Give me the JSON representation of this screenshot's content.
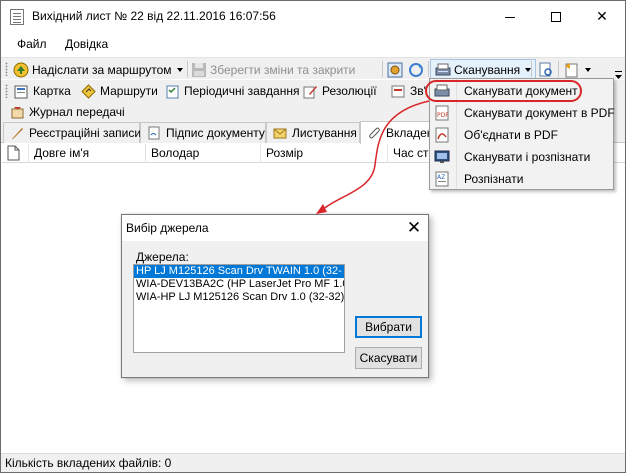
{
  "window": {
    "title": "Вихідний лист № 22 від 22.11.2016 16:07:56"
  },
  "menubar": {
    "items": [
      "Файл",
      "Довідка"
    ]
  },
  "toolbar": {
    "send_route": "Надіслати за маршрутом",
    "save_close": "Зберегти зміни та закрити",
    "scan": "Сканування"
  },
  "tabs_row1": [
    "Картка",
    "Маршрути",
    "Періодичні завдання",
    "Резолюції",
    "Зв'"
  ],
  "tabs_row2": [
    "Журнал передачі"
  ],
  "page_tabs": [
    "Реєстраційні записи",
    "Підпис документу",
    "Листування",
    "Вкладен"
  ],
  "grid": {
    "columns": [
      "Довге ім'я",
      "Володар",
      "Розмір",
      "Час ств"
    ]
  },
  "scan_menu": {
    "items": [
      "Сканувати документ",
      "Сканувати документ в PDF",
      "Об'єднати в PDF",
      "Сканувати і розпізнати",
      "Розпізнати"
    ]
  },
  "dialog": {
    "title": "Вибір джерела",
    "sources_label": "Джерела:",
    "sources": [
      "HP LJ M125126 Scan Drv TWAIN 1.0 (32-",
      "WIA-DEV13BA2C (HP LaserJet Pro MF 1.0",
      "WIA-HP LJ M125126 Scan Drv 1.0 (32-32)"
    ],
    "selected_index": 0,
    "select_button": "Вибрати",
    "cancel_button": "Скасувати"
  },
  "statusbar": {
    "text": "Кількість вкладених файлів: 0"
  },
  "colors": {
    "accent_red": "#d8262a",
    "selection_blue": "#0078d7"
  }
}
